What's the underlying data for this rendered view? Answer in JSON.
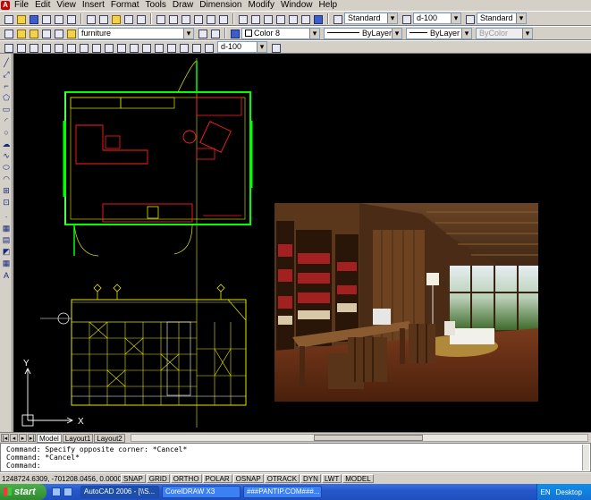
{
  "menu": {
    "items": [
      "File",
      "Edit",
      "View",
      "Insert",
      "Format",
      "Tools",
      "Draw",
      "Dimension",
      "Modify",
      "Window",
      "Help"
    ]
  },
  "toolbars": {
    "text_style": "Standard",
    "dim_style": "d-100",
    "table_style": "Standard",
    "layer": "furniture",
    "color": "Color 8",
    "linetype": "ByLayer",
    "lineweight": "ByLayer",
    "plotstyle": "ByColor",
    "dim_style2": "d-100"
  },
  "tabs": {
    "model": "Model",
    "layout1": "Layout1",
    "layout2": "Layout2"
  },
  "command": {
    "lines": [
      "Command: Specify opposite corner: *Cancel*",
      "Command: *Cancel*",
      "Command:"
    ]
  },
  "status": {
    "coords": "1248724.6309, -701208.0456, 0.0000",
    "buttons": [
      "SNAP",
      "GRID",
      "ORTHO",
      "POLAR",
      "OSNAP",
      "OTRACK",
      "DYN",
      "LWT",
      "MODEL"
    ]
  },
  "taskbar": {
    "start": "start",
    "tasks": [
      "AutoCAD 2006 - [\\\\S...",
      "CorelDRAW X3",
      "###PANTIP.COM###..."
    ],
    "language": "EN",
    "desktop": "Desktop"
  },
  "axis": {
    "x": "X",
    "y": "Y"
  },
  "colors": {
    "canvas": "#000000",
    "wall": "#00ff00",
    "furniture": "#ff2020",
    "elevation": "#e6e600",
    "xp_blue": "#2657c9"
  }
}
